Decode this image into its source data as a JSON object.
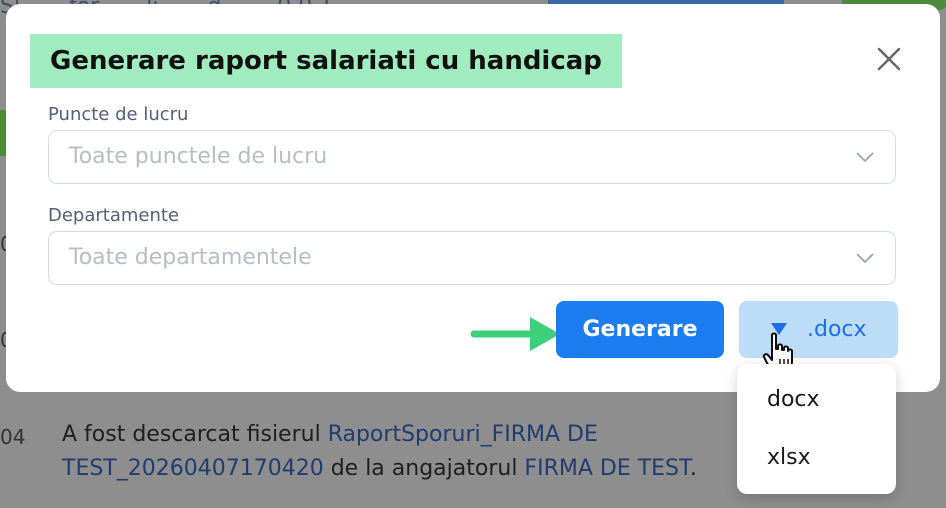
{
  "background": {
    "top_link_text": "Sl... ...for... ...li... ...d... ... 0.0.1",
    "side_numbers": [
      "0",
      "0"
    ],
    "row": {
      "number": "04",
      "text_before": "A fost descarcat fisierul ",
      "file_link": "RaportSporuri_FIRMA DE TEST_20260407170420",
      "text_middle": " de la angajatorul ",
      "employer_link": "FIRMA DE TEST",
      "text_after": "."
    }
  },
  "modal": {
    "title": "Generare raport salariati cu handicap",
    "fields": [
      {
        "label": "Puncte de lucru",
        "placeholder": "Toate punctele de lucru"
      },
      {
        "label": "Departamente",
        "placeholder": "Toate departamentele"
      }
    ],
    "generate_button": "Generare",
    "format_button": ".docx",
    "format_menu": [
      "docx",
      "xlsx"
    ]
  },
  "colors": {
    "primary": "#1c7cf2",
    "title_highlight": "#a0ecbe",
    "format_button_bg": "#bcdcf8",
    "hint_arrow": "#3ecf7a"
  },
  "icons": {
    "close": "close-icon",
    "chevron": "chevron-down-icon",
    "caret": "caret-down-icon",
    "cursor": "hand-pointer-icon",
    "hint": "arrow-right-icon"
  }
}
